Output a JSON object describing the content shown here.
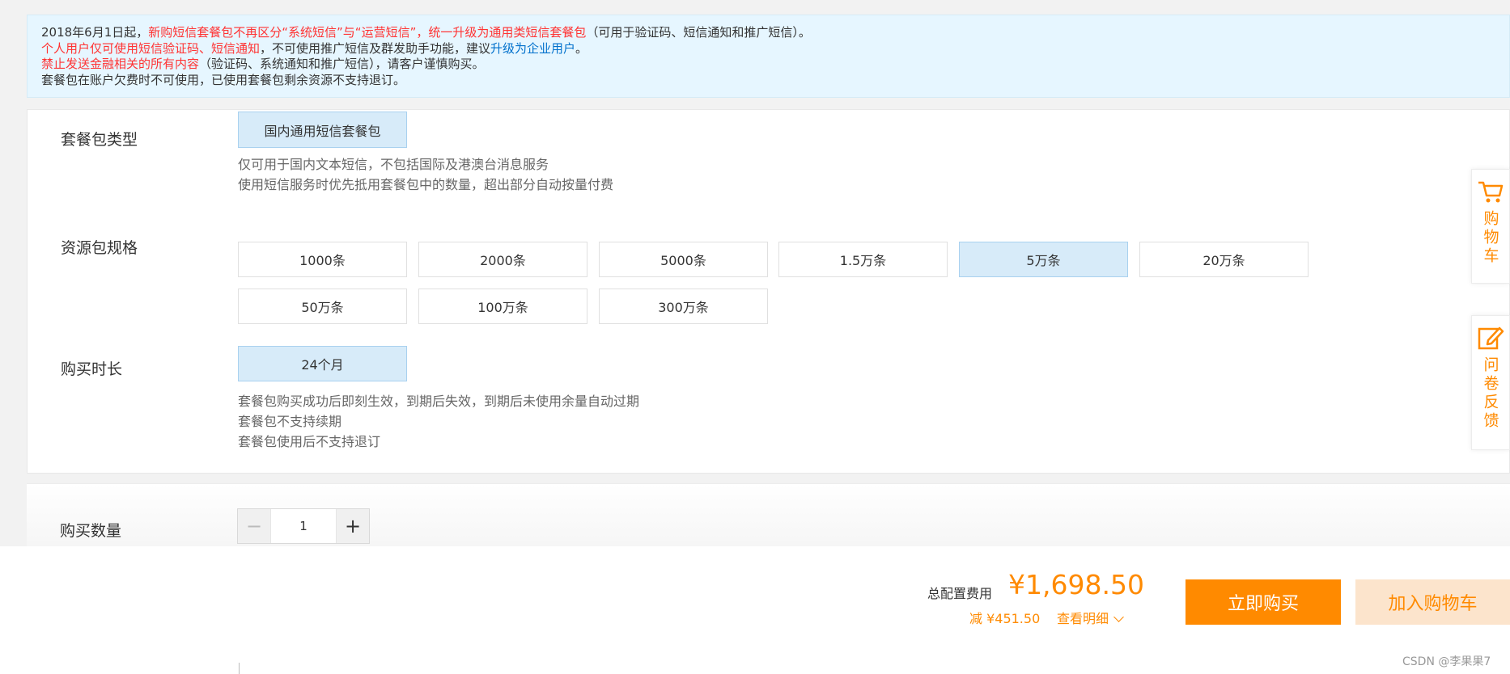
{
  "notice": {
    "line1": {
      "a": "2018年6月1日起，",
      "b": "新购短信套餐包不再区分“系统短信”与“运营短信”，统一升级为通用类短信套餐包",
      "c": "（可用于验证码、短信通知和推广短信）。"
    },
    "line2": {
      "a": "个人用户仅可使用短信验证码、短信通知",
      "b": "，不可使用推广短信及群发助手功能，建议",
      "c": "升级为企业用户",
      "d": "。"
    },
    "line3": {
      "a": "禁止发送金融相关的所有内容",
      "b": "（验证码、系统通知和推广短信），请客户谨慎购买。"
    },
    "line4": "套餐包在账户欠费时不可使用，已使用套餐包剩余资源不支持退订。"
  },
  "package_type": {
    "label": "套餐包类型",
    "option": "国内通用短信套餐包",
    "desc1": "仅可用于国内文本短信，不包括国际及港澳台消息服务",
    "desc2": "使用短信服务时优先抵用套餐包中的数量，超出部分自动按量付费"
  },
  "spec": {
    "label": "资源包规格",
    "options": [
      "1000条",
      "2000条",
      "5000条",
      "1.5万条",
      "5万条",
      "20万条",
      "50万条",
      "100万条",
      "300万条"
    ],
    "selected": "5万条"
  },
  "duration": {
    "label": "购买时长",
    "option": "24个月",
    "desc1": "套餐包购买成功后即刻生效，到期后失效，到期后未使用余量自动过期",
    "desc2": "套餐包不支持续期",
    "desc3": "套餐包使用后不支持退订"
  },
  "quantity": {
    "label": "购买数量",
    "value": "1",
    "minus": "−",
    "plus": "+"
  },
  "footer": {
    "fee_label": "总配置费用",
    "total": "¥1,698.50",
    "discount": "减 ¥451.50",
    "detail": "查看明细",
    "buy": "立即购买",
    "add_cart": "加入购物车",
    "watermark": "CSDN @李果果7"
  },
  "sidebar": {
    "cart": "购物车",
    "survey": "问卷反馈"
  },
  "colors": {
    "accent": "#ff8a00",
    "selected_bg": "#d7ebf9",
    "notice_bg": "#e6f6ff",
    "warning": "#ff3333",
    "link": "#0070cc"
  }
}
